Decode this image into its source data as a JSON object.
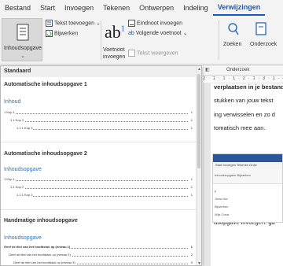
{
  "ribbon_tabs": [
    "Bestand",
    "Start",
    "Invoegen",
    "Tekenen",
    "Ontwerpen",
    "Indeling",
    "Verwijzingen"
  ],
  "ribbon": {
    "toc_button": "Inhoudsopgave",
    "add_text": "Tekst toevoegen",
    "update": "Bijwerken",
    "footnote_line1": "Voetnoot",
    "footnote_line2": "invoegen",
    "endnote": "Eindnoot invoegen",
    "next_footnote": "Volgende voetnoot",
    "show_notes": "Tekst weergeven",
    "search": "Zoeken",
    "research": "Onderzoek"
  },
  "colors": {
    "accent": "#185abd",
    "heading": "#2e74b5",
    "ribbon_bg": "#f3f3f3"
  },
  "icons": [
    "toc-icon",
    "add-text-icon",
    "update-icon",
    "endnote-icon",
    "next-footnote-icon",
    "show-notes-icon",
    "search-icon",
    "researcher-icon"
  ],
  "gallery": {
    "header": "Standaard",
    "auto1": {
      "title": "Automatische inhoudsopgave 1",
      "heading": "Inhoud",
      "entries": [
        {
          "text": "1    Kop 1",
          "page": "1"
        },
        {
          "text": "1.1    Kop 2",
          "page": "1"
        },
        {
          "text": "1.1.1    Kop 3",
          "page": "1"
        }
      ]
    },
    "auto2": {
      "title": "Automatische inhoudsopgave 2",
      "heading": "Inhoudsopgave",
      "entries": [
        {
          "text": "1    Kop 1",
          "page": "1"
        },
        {
          "text": "1.1    Kop 2",
          "page": "1"
        },
        {
          "text": "1.1.1    Kop 3",
          "page": "1"
        }
      ]
    },
    "manual": {
      "title": "Handmatige inhoudsopgave",
      "heading": "Inhoudsopgave",
      "entries": [
        {
          "text": "Geef de titel van het hoofdstuk op (niveau 1)",
          "page": "1"
        },
        {
          "text": "Geef de titel van het hoofdstuk op (niveau 2)",
          "page": "2"
        },
        {
          "text": "Geef de titel van het hoofdstuk op (niveau 3)",
          "page": "3"
        }
      ]
    }
  },
  "document": {
    "pane_title": "Onderzoek",
    "ruler": "2 · 1 · 1 · 1 · 2 · 1 · 3 · 1 · 4 · 1 · 5",
    "lines": [
      "verplaatsen in je bestand",
      "stukken van jouw tekst",
      "ing verwisselen en zo d",
      "tomatisch mee aan."
    ],
    "bottom_line": "dsopgave invoegen: ga",
    "shot": {
      "tabs": "Start  Invoegen  Tekenen  Ontw",
      "rows": [
        "Inhoudsopgave  Bijwerken",
        "p",
        "Jouw doc",
        "Bijwerken",
        "Wijs Crear"
      ]
    }
  }
}
